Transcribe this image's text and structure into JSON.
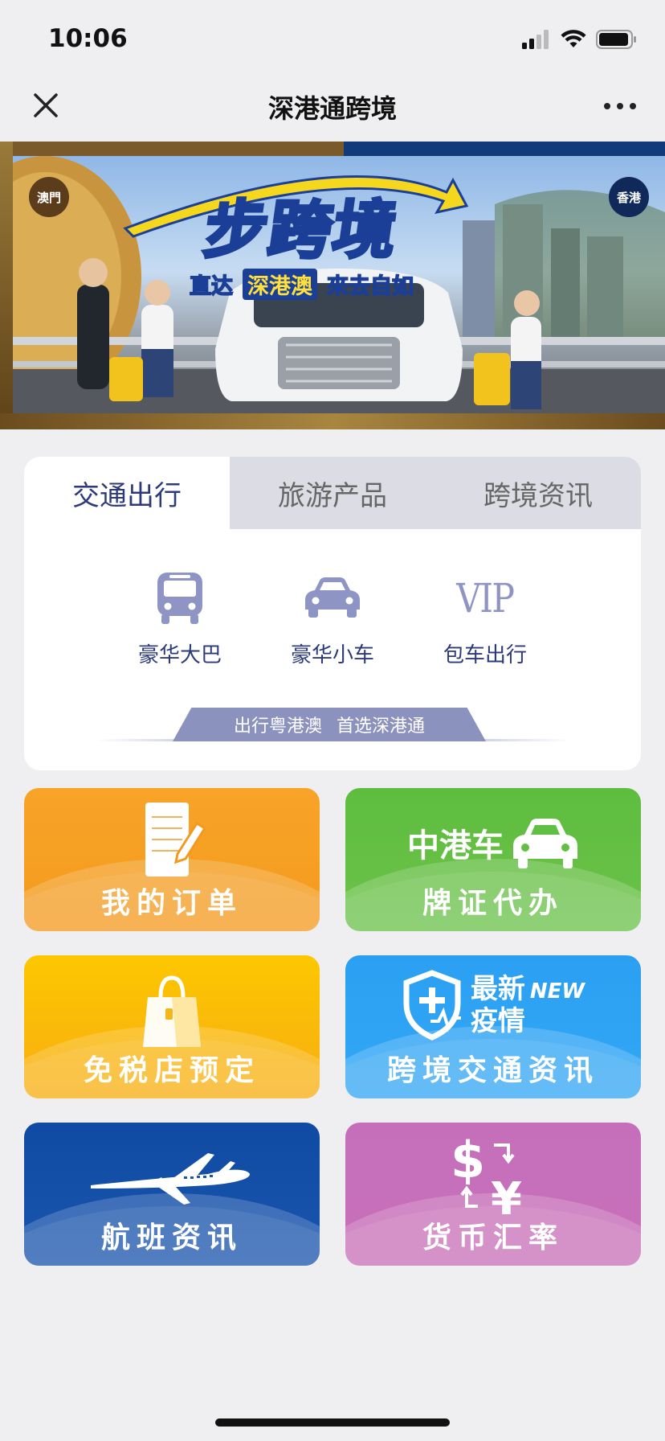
{
  "status_bar": {
    "time": "10:06"
  },
  "nav": {
    "title": "深港通跨境"
  },
  "banner": {
    "badge_left": "澳門",
    "badge_right": "香港",
    "headline": "步跨境",
    "sub_1": "直达",
    "sub_2": "深港澳",
    "sub_3": "來去自如"
  },
  "tabs": [
    {
      "label": "交通出行",
      "active": true
    },
    {
      "label": "旅游产品",
      "active": false
    },
    {
      "label": "跨境资讯",
      "active": false
    }
  ],
  "services": [
    {
      "label": "豪华大巴",
      "icon": "bus-icon"
    },
    {
      "label": "豪华小车",
      "icon": "car-icon"
    },
    {
      "label": "包车出行",
      "icon": "vip-icon",
      "icon_text": "VIP"
    }
  ],
  "slogan": {
    "part1": "出行粤港澳",
    "part2": "首选深港通"
  },
  "tiles": {
    "orders": {
      "label": "我的订单",
      "icon": "order-note-icon"
    },
    "plate": {
      "label": "牌证代办",
      "icon_text": "中港车",
      "icon": "car-icon"
    },
    "dutyfree": {
      "label": "免税店预定",
      "icon": "shopping-bag-icon"
    },
    "traffic": {
      "label": "跨境交通资讯",
      "icon_line1": "最新",
      "icon_new": "NEW",
      "icon_line2": "疫情",
      "icon": "shield-plus-icon"
    },
    "flight": {
      "label": "航班资讯",
      "icon": "airplane-icon"
    },
    "currency": {
      "label": "货币汇率",
      "icon": "currency-exchange-icon"
    }
  },
  "colors": {
    "accent": "#2c3a7a",
    "orders": "#f6a022",
    "plate": "#64c044",
    "dutyfree": "#fbbd06",
    "traffic": "#30a4f4",
    "flight": "#134fa8",
    "currency": "#c66fb9"
  }
}
